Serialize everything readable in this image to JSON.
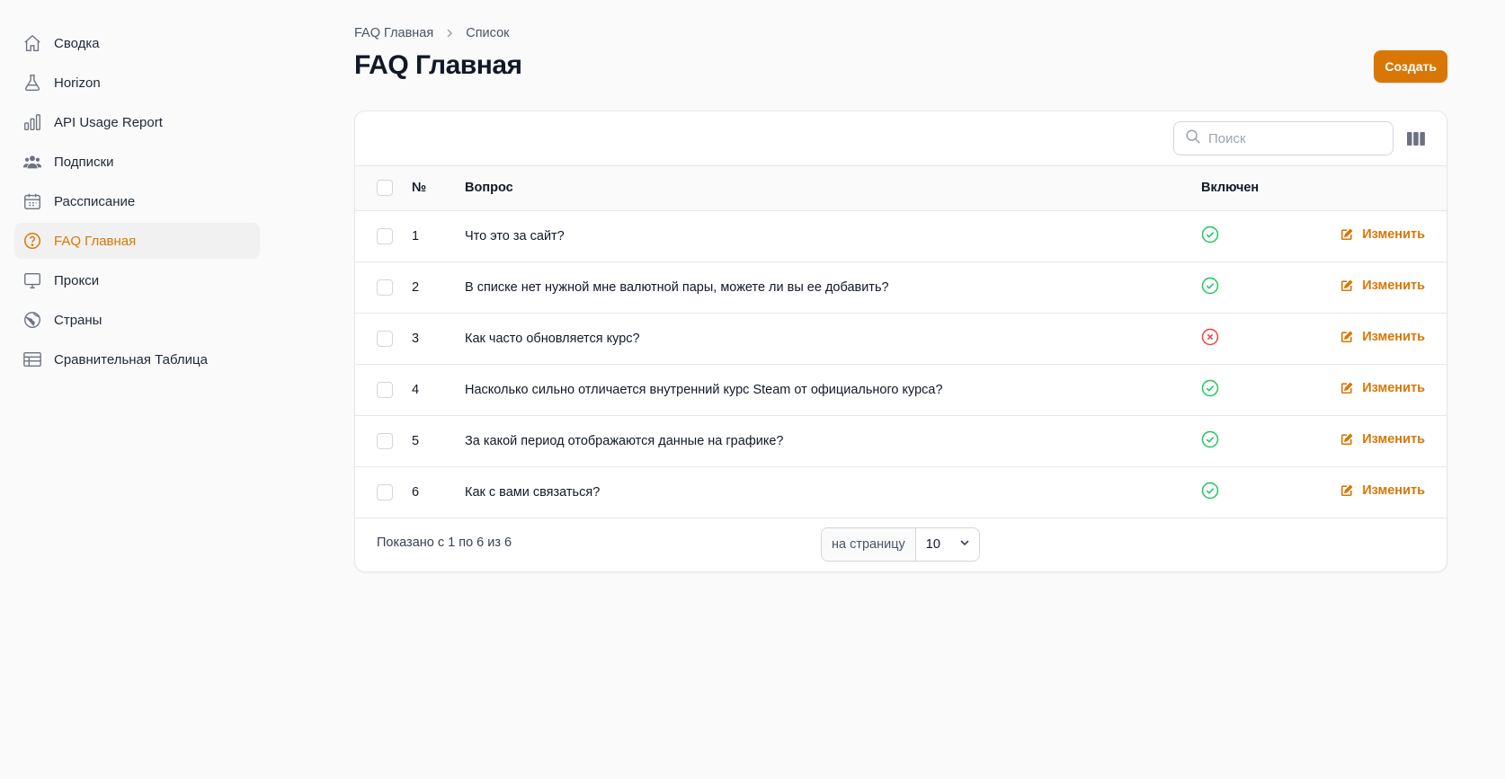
{
  "sidebar": {
    "items": [
      {
        "label": "Сводка",
        "icon": "home-icon",
        "active": false
      },
      {
        "label": "Horizon",
        "icon": "flask-icon",
        "active": false
      },
      {
        "label": "API Usage Report",
        "icon": "bar-chart-icon",
        "active": false
      },
      {
        "label": "Подписки",
        "icon": "users-icon",
        "active": false
      },
      {
        "label": "Рассписание",
        "icon": "calendar-icon",
        "active": false
      },
      {
        "label": "FAQ Главная",
        "icon": "question-circle-icon",
        "active": true
      },
      {
        "label": "Прокси",
        "icon": "monitor-icon",
        "active": false
      },
      {
        "label": "Страны",
        "icon": "globe-icon",
        "active": false
      },
      {
        "label": "Сравнительная Таблица",
        "icon": "table-icon",
        "active": false
      }
    ]
  },
  "breadcrumb": {
    "root": "FAQ Главная",
    "current": "Список"
  },
  "page": {
    "title": "FAQ Главная",
    "create_label": "Создать"
  },
  "search": {
    "placeholder": "Поиск"
  },
  "table": {
    "headers": {
      "num": "№",
      "question": "Вопрос",
      "enabled": "Включен"
    },
    "edit_label": "Изменить",
    "rows": [
      {
        "num": "1",
        "question": "Что это за сайт?",
        "enabled": true
      },
      {
        "num": "2",
        "question": "В списке нет нужной мне валютной пары, можете ли вы ее добавить?",
        "enabled": true
      },
      {
        "num": "3",
        "question": "Как часто обновляется курс?",
        "enabled": false
      },
      {
        "num": "4",
        "question": "Насколько сильно отличается внутренний курс Steam от официального курса?",
        "enabled": true
      },
      {
        "num": "5",
        "question": "За какой период отображаются данные на графике?",
        "enabled": true
      },
      {
        "num": "6",
        "question": "Как с вами связаться?",
        "enabled": true
      }
    ]
  },
  "footer": {
    "shown": "Показано с 1 по 6 из 6",
    "per_page_label": "на страницу",
    "per_page_value": "10"
  },
  "colors": {
    "accent": "#d97706",
    "success": "#22c55e",
    "danger": "#ef4444"
  }
}
